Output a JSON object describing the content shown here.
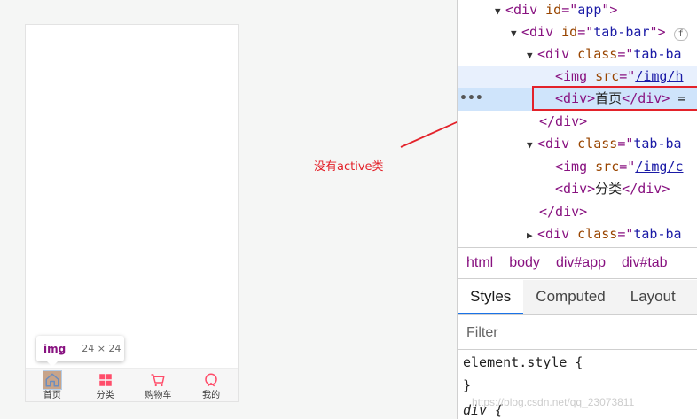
{
  "preview": {
    "tabbar": {
      "items": [
        {
          "label": "首页",
          "icon": "home-icon",
          "color": "#6b8dbf"
        },
        {
          "label": "分类",
          "icon": "category-grid-icon",
          "color": "#ff4d6a"
        },
        {
          "label": "购物车",
          "icon": "cart-icon",
          "color": "#ff4d6a"
        },
        {
          "label": "我的",
          "icon": "profile-icon",
          "color": "#ff4d6a"
        }
      ]
    },
    "tooltip": {
      "tag": "img",
      "dims": "24 × 24"
    }
  },
  "annotation": {
    "text": "没有active类",
    "color": "#e3222a"
  },
  "devtools": {
    "dom": {
      "l1": {
        "open": "<div ",
        "attr": "id",
        "eq": "=\"",
        "val": "app",
        "close": "\">"
      },
      "l2": {
        "open": "<div ",
        "attr": "id",
        "eq": "=\"",
        "val": "tab-bar",
        "close": "\">",
        "badge": "f"
      },
      "l3": {
        "open": "<div ",
        "attr": "class",
        "eq": "=\"",
        "val": "tab-ba"
      },
      "l4": {
        "open": "<img ",
        "attr": "src",
        "eq": "=\"",
        "val": "/img/h"
      },
      "l5": {
        "open": "<div>",
        "text": "首页",
        "close": "</div>",
        "suffix": " ="
      },
      "l6": {
        "close": "</div>"
      },
      "l7": {
        "open": "<div ",
        "attr": "class",
        "eq": "=\"",
        "val": "tab-ba"
      },
      "l8": {
        "open": "<img ",
        "attr": "src",
        "eq": "=\"",
        "val": "/img/c"
      },
      "l9": {
        "open": "<div>",
        "text": "分类",
        "close": "</div>"
      },
      "l10": {
        "close": "</div>"
      },
      "l11": {
        "open": "<div ",
        "attr": "class",
        "eq": "=\"",
        "val": "tab-ba"
      },
      "dots": "•••"
    },
    "breadcrumb": [
      "html",
      "body",
      "div#app",
      "div#tab"
    ],
    "tabs": [
      "Styles",
      "Computed",
      "Layout"
    ],
    "filter_placeholder": "Filter",
    "styles": {
      "line1": "element.style {",
      "line2": "}",
      "line3": "div {"
    }
  },
  "watermark": "https://blog.csdn.net/qq_23073811"
}
